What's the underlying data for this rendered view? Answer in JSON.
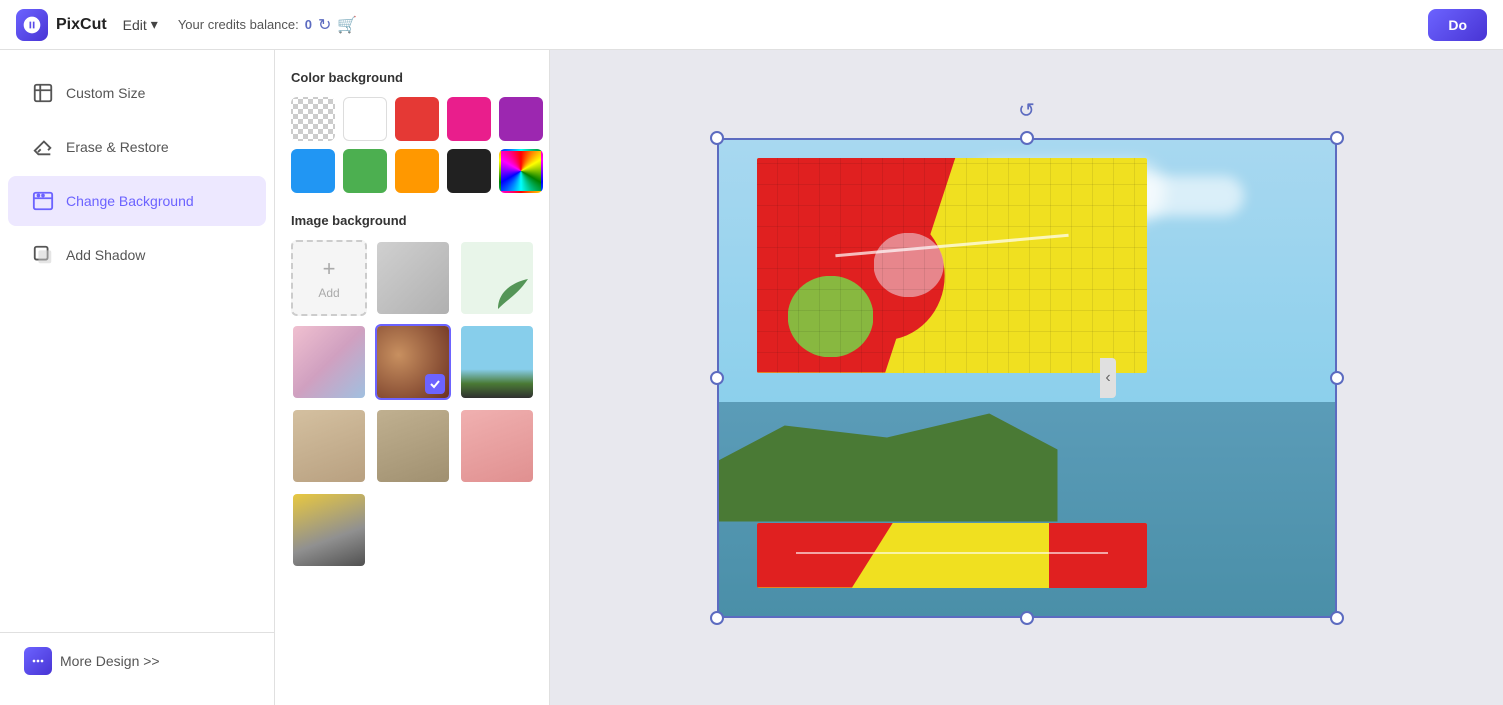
{
  "header": {
    "logo_text": "PixCut",
    "edit_label": "Edit",
    "credits_label": "Your credits balance:",
    "credits_count": "0",
    "download_label": "Do"
  },
  "sidebar": {
    "items": [
      {
        "id": "custom-size",
        "label": "Custom Size"
      },
      {
        "id": "erase-restore",
        "label": "Erase & Restore"
      },
      {
        "id": "change-background",
        "label": "Change Background",
        "active": true
      },
      {
        "id": "add-shadow",
        "label": "Add Shadow"
      }
    ],
    "more_design_label": "More Design >>"
  },
  "panel": {
    "color_bg_title": "Color background",
    "image_bg_title": "Image background",
    "add_label": "Add",
    "colors": [
      {
        "id": "transparent",
        "type": "transparent"
      },
      {
        "id": "white",
        "hex": "#ffffff"
      },
      {
        "id": "red",
        "hex": "#e53935"
      },
      {
        "id": "pink",
        "hex": "#e91e8c"
      },
      {
        "id": "purple",
        "hex": "#9c27b0"
      },
      {
        "id": "blue",
        "hex": "#2196f3"
      },
      {
        "id": "green",
        "hex": "#4caf50"
      },
      {
        "id": "orange",
        "hex": "#ff9800"
      },
      {
        "id": "black",
        "hex": "#212121"
      },
      {
        "id": "gradient",
        "type": "gradient"
      }
    ],
    "image_bgs": [
      {
        "id": "add",
        "type": "add"
      },
      {
        "id": "gray",
        "type": "gray"
      },
      {
        "id": "leaf",
        "type": "leaf"
      },
      {
        "id": "peach",
        "type": "peach"
      },
      {
        "id": "bokeh",
        "type": "bokeh",
        "selected": true
      },
      {
        "id": "sky",
        "type": "sky"
      },
      {
        "id": "arch",
        "type": "arch"
      },
      {
        "id": "street",
        "type": "street"
      },
      {
        "id": "pink-door",
        "type": "pink-door"
      },
      {
        "id": "taxi",
        "type": "taxi"
      }
    ]
  }
}
